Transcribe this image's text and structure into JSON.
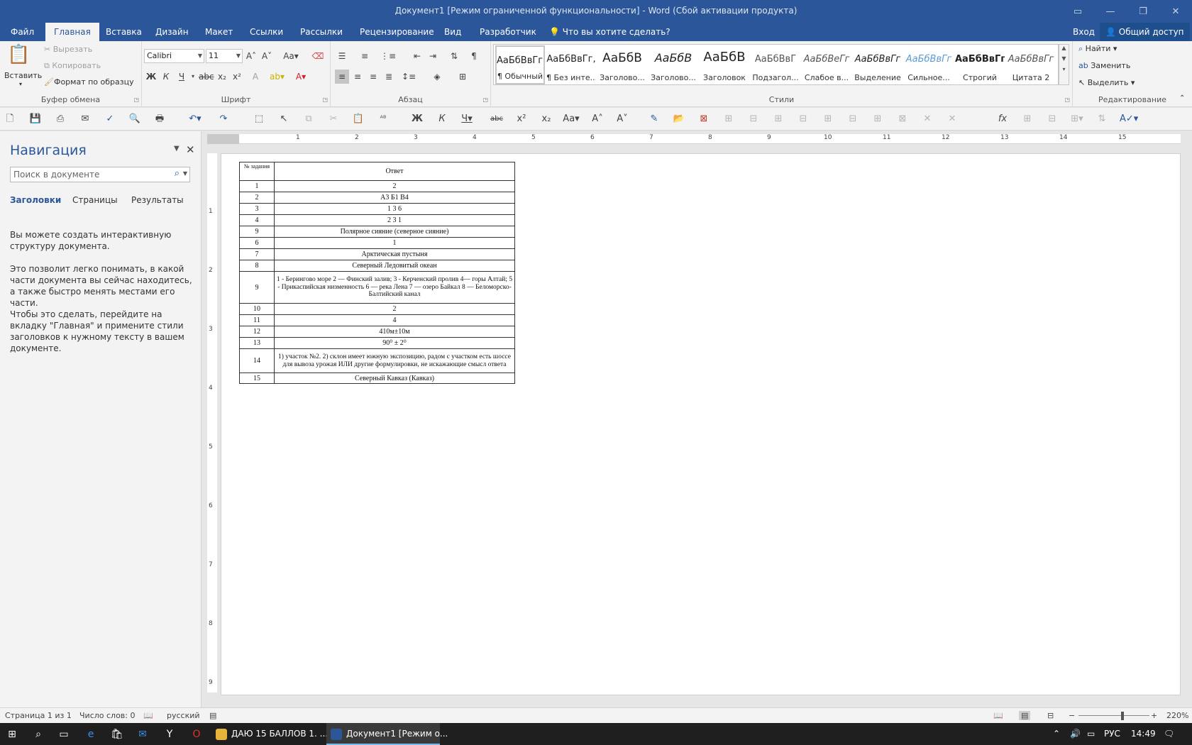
{
  "window": {
    "title": "Документ1 [Режим ограниченной функциональности] - Word (Сбой активации продукта)",
    "minimize": "—",
    "restore": "❐",
    "close": "✕",
    "ribbon_display": "▭"
  },
  "tabs": [
    {
      "label": "Файл"
    },
    {
      "label": "Главная"
    },
    {
      "label": "Вставка"
    },
    {
      "label": "Дизайн"
    },
    {
      "label": "Макет"
    },
    {
      "label": "Ссылки"
    },
    {
      "label": "Рассылки"
    },
    {
      "label": "Рецензирование"
    },
    {
      "label": "Вид"
    },
    {
      "label": "Разработчик"
    }
  ],
  "tell_me": "Что вы хотите сделать?",
  "signin": "Вход",
  "share": "Общий доступ",
  "clipboard": {
    "paste": "Вставить",
    "cut": "Вырезать",
    "copy": "Копировать",
    "format_painter": "Формат по образцу",
    "label": "Буфер обмена"
  },
  "font": {
    "name": "Calibri",
    "size": "11",
    "label": "Шрифт",
    "bold": "Ж",
    "italic": "К",
    "underline": "Ч"
  },
  "paragraph": {
    "label": "Абзац"
  },
  "styles": {
    "label": "Стили",
    "items": [
      {
        "sample": "АаБбВвГг,",
        "name": "¶ Обычный"
      },
      {
        "sample": "АаБбВвГг,",
        "name": "¶ Без инте..."
      },
      {
        "sample": "АаБбВ",
        "name": "Заголово..."
      },
      {
        "sample": "АаБбВ",
        "name": "Заголово..."
      },
      {
        "sample": "АаБбВ",
        "name": "Заголовок"
      },
      {
        "sample": "АаБбВвГ",
        "name": "Подзагол..."
      },
      {
        "sample": "АаБбВеГг",
        "name": "Слабое в..."
      },
      {
        "sample": "АаБбВвГг",
        "name": "Выделение"
      },
      {
        "sample": "АаБбВвГг",
        "name": "Сильное..."
      },
      {
        "sample": "АаБбВвГг,",
        "name": "Строгий"
      },
      {
        "sample": "АаБбВвГг",
        "name": "Цитата 2"
      }
    ]
  },
  "editing": {
    "label": "Редактирование",
    "find": "Найти",
    "replace": "Заменить",
    "select": "Выделить"
  },
  "navigation": {
    "title": "Навигация",
    "search_placeholder": "Поиск в документе",
    "tabs": [
      "Заголовки",
      "Страницы",
      "Результаты"
    ],
    "para1": "Вы можете создать интерактивную структуру документа.",
    "para2": "Это позволит легко понимать, в какой части документа вы сейчас находитесь, а также быстро менять местами его части.",
    "para3": "Чтобы это сделать, перейдите на вкладку \"Главная\" и примените стили заголовков к нужному тексту в вашем документе."
  },
  "ruler": {
    "h_ticks": [
      "1",
      "2",
      "3",
      "4",
      "5",
      "6",
      "7",
      "8",
      "9",
      "10",
      "11",
      "12",
      "13",
      "14",
      "15"
    ],
    "v_ticks": [
      "1",
      "2",
      "3",
      "4",
      "5",
      "6",
      "7",
      "8",
      "9"
    ]
  },
  "table": {
    "header_num": "№ задания",
    "header_answer": "Ответ",
    "rows": [
      {
        "num": "1",
        "answer": "2"
      },
      {
        "num": "2",
        "answer": "А3  Б1  В4"
      },
      {
        "num": "3",
        "answer": "1  3  6"
      },
      {
        "num": "4",
        "answer": "2  3  1"
      },
      {
        "num": "9",
        "answer": "Полярное сияние (северное сияние)"
      },
      {
        "num": "6",
        "answer": "1"
      },
      {
        "num": "7",
        "answer": "Арктическая пустыня"
      },
      {
        "num": "8",
        "answer": "Северный Ледовитый океан"
      },
      {
        "num": "9",
        "answer": "1  - Берингово море 2 — Финский залив; 3  - Керченский пролив 4— горы Алтай; 5 - Прикаспийская низменность 6 — река Лена 7 — озеро Байкал 8 — Беломорско-Балтийский канал"
      },
      {
        "num": "10",
        "answer": "2"
      },
      {
        "num": "11",
        "answer": "4"
      },
      {
        "num": "12",
        "answer": "410м±10м"
      },
      {
        "num": "13",
        "answer": "90⁰ ± 2⁰"
      },
      {
        "num": "14",
        "answer": "1) участок №2.  2) склон имеет южную экспозицию, радом с участком есть шоссе для вывоза урожая ИЛИ другие формулировки, не искажающие смысл ответа"
      },
      {
        "num": "15",
        "answer": "Северный Кавказ (Кавказ)"
      }
    ]
  },
  "status": {
    "page": "Страница 1 из 1",
    "words": "Число слов: 0",
    "language": "русский",
    "zoom": "220%"
  },
  "taskbar": {
    "chrome_title": "ДАЮ 15 БАЛЛОВ 1. ...",
    "word_title": "Документ1 [Режим о...",
    "lang": "РУС",
    "time": "14:49"
  }
}
